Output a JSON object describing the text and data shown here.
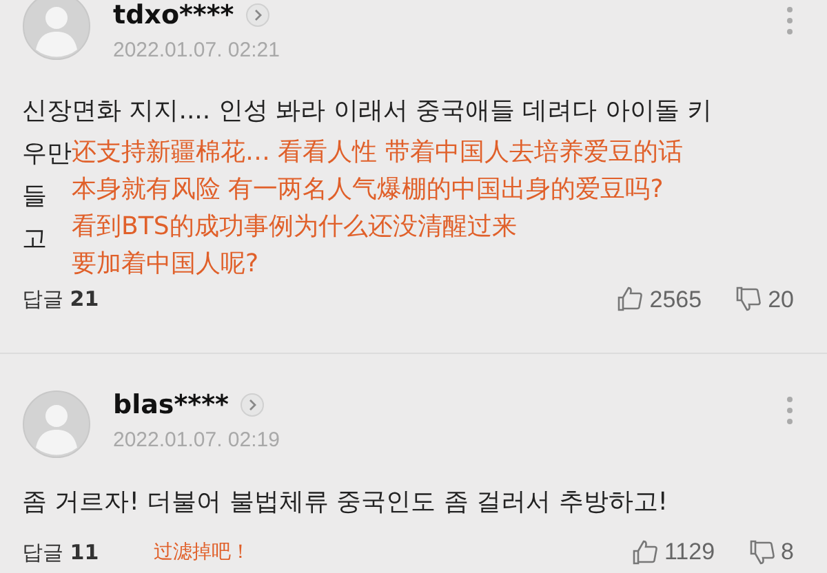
{
  "comments": [
    {
      "author": "tdxo****",
      "date": "2022.01.07. 02:21",
      "body_lines": [
        "신장면화 지지.... 인성 봐라 이래서 중국애들 데려다 아이돌 키",
        "우만",
        "들",
        "고"
      ],
      "reply_label": "답글",
      "reply_count": "21",
      "likes": "2565",
      "dislikes": "20",
      "translation_overlay": [
        "还支持新疆棉花… 看看人性 带着中国人去培养爱豆的话",
        "本身就有风险 有一两名人气爆棚的中国出身的爱豆吗?",
        "看到BTS的成功事例为什么还没清醒过来",
        "要加着中国人呢?"
      ]
    },
    {
      "author": "blas****",
      "date": "2022.01.07. 02:19",
      "body_lines": [
        "좀 거르자! 더불어 불법체류 중국인도 좀 걸러서 추방하고!"
      ],
      "reply_label": "답글",
      "reply_count": "11",
      "likes": "1129",
      "dislikes": "8",
      "footer_translation": "过滤掉吧！"
    }
  ]
}
